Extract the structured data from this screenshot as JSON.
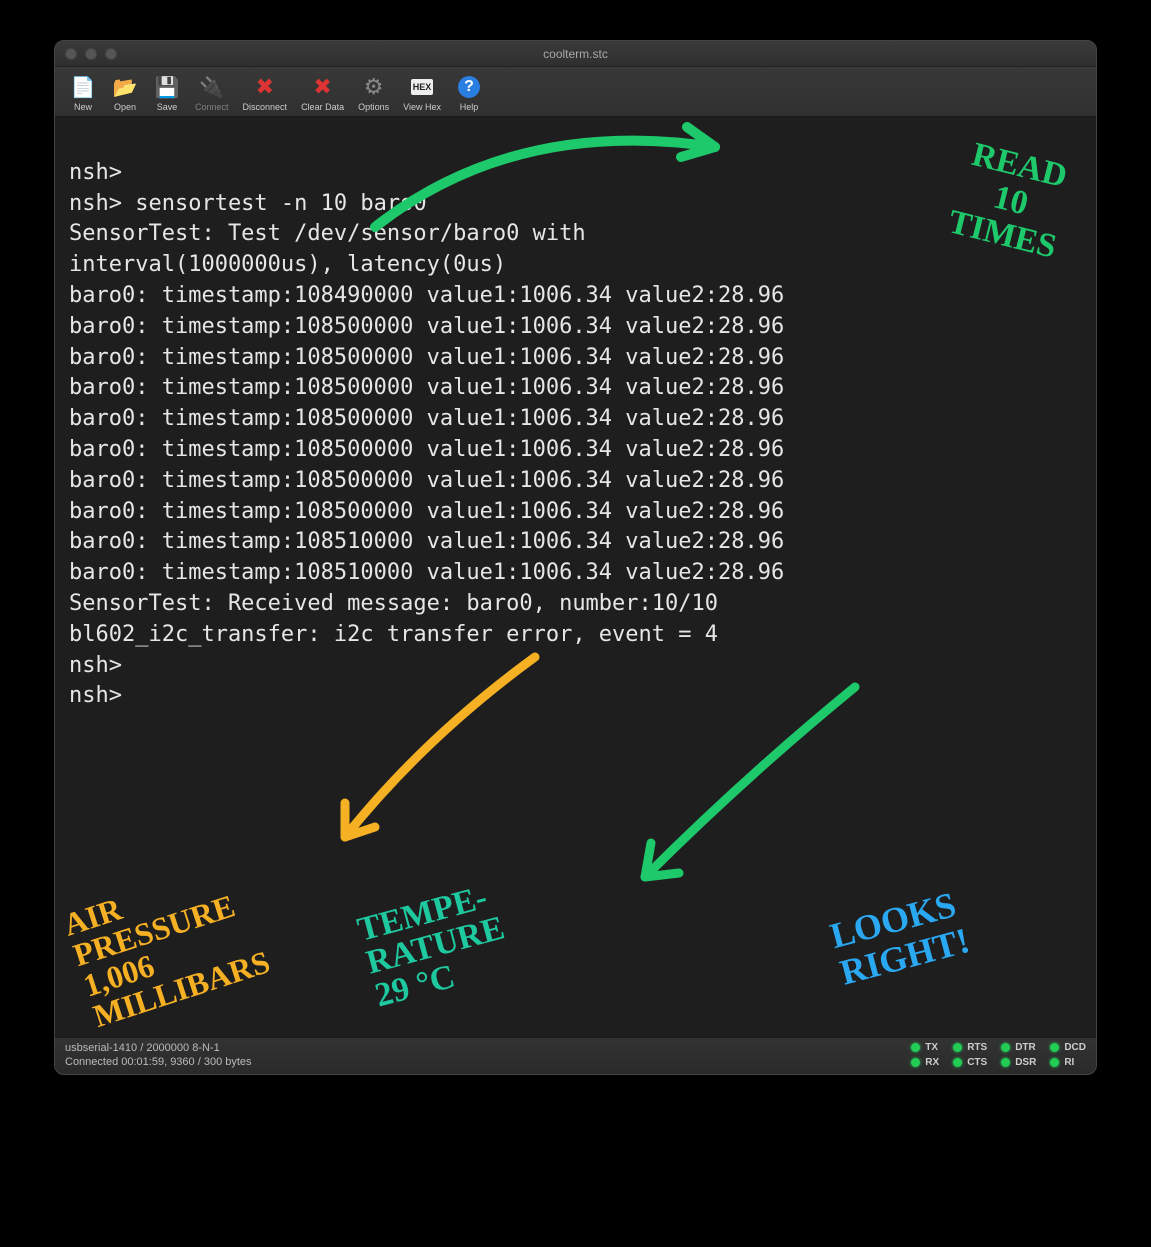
{
  "window": {
    "title": "coolterm.stc"
  },
  "toolbar": [
    {
      "name": "new-button",
      "label": "New",
      "icon": "📄",
      "interact": true,
      "disabled": false
    },
    {
      "name": "open-button",
      "label": "Open",
      "icon": "📂",
      "interact": true,
      "disabled": false
    },
    {
      "name": "save-button",
      "label": "Save",
      "icon": "💾",
      "interact": true,
      "disabled": false
    },
    {
      "name": "connect-button",
      "label": "Connect",
      "icon": "🔌",
      "interact": true,
      "disabled": true
    },
    {
      "name": "disconnect-button",
      "label": "Disconnect",
      "icon": "✖",
      "interact": true,
      "disabled": false
    },
    {
      "name": "clear-data-button",
      "label": "Clear Data",
      "icon": "✖",
      "interact": true,
      "disabled": false
    },
    {
      "name": "options-button",
      "label": "Options",
      "icon": "⚙",
      "interact": true,
      "disabled": false
    },
    {
      "name": "view-hex-button",
      "label": "View Hex",
      "icon": "HEX",
      "interact": true,
      "disabled": false
    },
    {
      "name": "help-button",
      "label": "Help",
      "icon": "?",
      "interact": true,
      "disabled": false
    }
  ],
  "terminal": {
    "lines": [
      "nsh>",
      "nsh> sensortest -n 10 baro0",
      "SensorTest: Test /dev/sensor/baro0 with",
      "interval(1000000us), latency(0us)",
      "baro0: timestamp:108490000 value1:1006.34 value2:28.96",
      "baro0: timestamp:108500000 value1:1006.34 value2:28.96",
      "baro0: timestamp:108500000 value1:1006.34 value2:28.96",
      "baro0: timestamp:108500000 value1:1006.34 value2:28.96",
      "baro0: timestamp:108500000 value1:1006.34 value2:28.96",
      "baro0: timestamp:108500000 value1:1006.34 value2:28.96",
      "baro0: timestamp:108500000 value1:1006.34 value2:28.96",
      "baro0: timestamp:108500000 value1:1006.34 value2:28.96",
      "baro0: timestamp:108510000 value1:1006.34 value2:28.96",
      "baro0: timestamp:108510000 value1:1006.34 value2:28.96",
      "SensorTest: Received message: baro0, number:10/10",
      "bl602_i2c_transfer: i2c transfer error, event = 4",
      "nsh>",
      "nsh> "
    ]
  },
  "status": {
    "port": "usbserial-1410 / 2000000 8-N-1",
    "conn": "Connected 00:01:59, 9360 / 300 bytes",
    "leds": [
      {
        "label": "TX",
        "on": true
      },
      {
        "label": "RTS",
        "on": true
      },
      {
        "label": "DTR",
        "on": true
      },
      {
        "label": "DCD",
        "on": true
      },
      {
        "label": "RX",
        "on": true
      },
      {
        "label": "CTS",
        "on": true
      },
      {
        "label": "DSR",
        "on": true
      },
      {
        "label": "RI",
        "on": true
      }
    ]
  },
  "annotations": {
    "read10": "READ\n10\nTIMES",
    "pressure": "AIR\nPRESSURE\n1,006\nMILLIBARS",
    "temp": "TEMPE-\nRATURE\n29 °C",
    "looks": "LOOKS\nRIGHT!"
  }
}
